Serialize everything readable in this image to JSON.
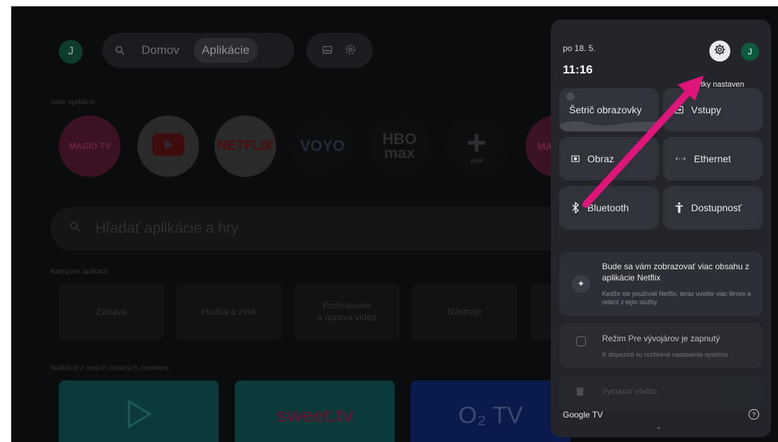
{
  "profile": {
    "initial": "J"
  },
  "nav": {
    "items": [
      {
        "label": "Domov",
        "active": false
      },
      {
        "label": "Aplikácie",
        "active": true
      }
    ],
    "icons": [
      "search-icon",
      "photo-frame-icon",
      "settings-icon"
    ]
  },
  "apps_section": {
    "label": "Vaše aplikácie",
    "apps": [
      {
        "name": "MAGIO TV",
        "color": "#3b1224"
      },
      {
        "name": "YouTube",
        "color": "#2a2a2a"
      },
      {
        "name": "NETFLIX",
        "color": "#2a2a2a"
      },
      {
        "name": "VOYO",
        "color": "#0d0e10"
      },
      {
        "name": "HBO max",
        "color": "#0d0e10"
      },
      {
        "name": "APP",
        "color": "#0d0e10"
      },
      {
        "name": "MAG TV",
        "color": "#3b1224"
      }
    ]
  },
  "search": {
    "placeholder": "Hľadať aplikácie a hry"
  },
  "categories_section": {
    "label": "Kategórie aplikácií",
    "items": [
      "Zábava",
      "Hudba a zvuk",
      "Prehrávanie\na úprava videa",
      "Nástroje"
    ]
  },
  "other_devices_section": {
    "label": "Aplikácie z mojich ostatných zariadení",
    "tiles": [
      "",
      "sweet.tv",
      "O₂ TV"
    ]
  },
  "quick_panel": {
    "date": "po 18. 5.",
    "time": "11:16",
    "avatar_initial": "J",
    "all_settings_label": "Všetky nastaven",
    "tiles": [
      {
        "label": "Šetrič obrazovky",
        "icon": "screensaver-icon"
      },
      {
        "label": "Vstupy",
        "icon": "input-icon"
      },
      {
        "label": "Obraz",
        "icon": "picture-icon"
      },
      {
        "label": "Ethernet",
        "icon": "ethernet-icon"
      },
      {
        "label": "Bluetooth",
        "icon": "bluetooth-icon"
      },
      {
        "label": "Dostupnosť",
        "icon": "accessibility-icon"
      }
    ],
    "notifications": [
      {
        "title": "Bude sa vám zobrazovať viac obsahu z aplikácie Netflix",
        "subtitle": "Keďže ste používali Netflix, teraz uvidíte viac filmov a relácií z tejto služby",
        "icon": "sparkle-icon"
      },
      {
        "title": "Režim Pre vývojárov je zapnutý",
        "subtitle": "K dispozícii sú rozšírené nastavenia systému",
        "icon": "developer-icon"
      }
    ],
    "clear_all_label": "Vymazať všetko",
    "footer_brand": "Google TV"
  },
  "annotation": {
    "arrow_color": "#e0157a"
  }
}
